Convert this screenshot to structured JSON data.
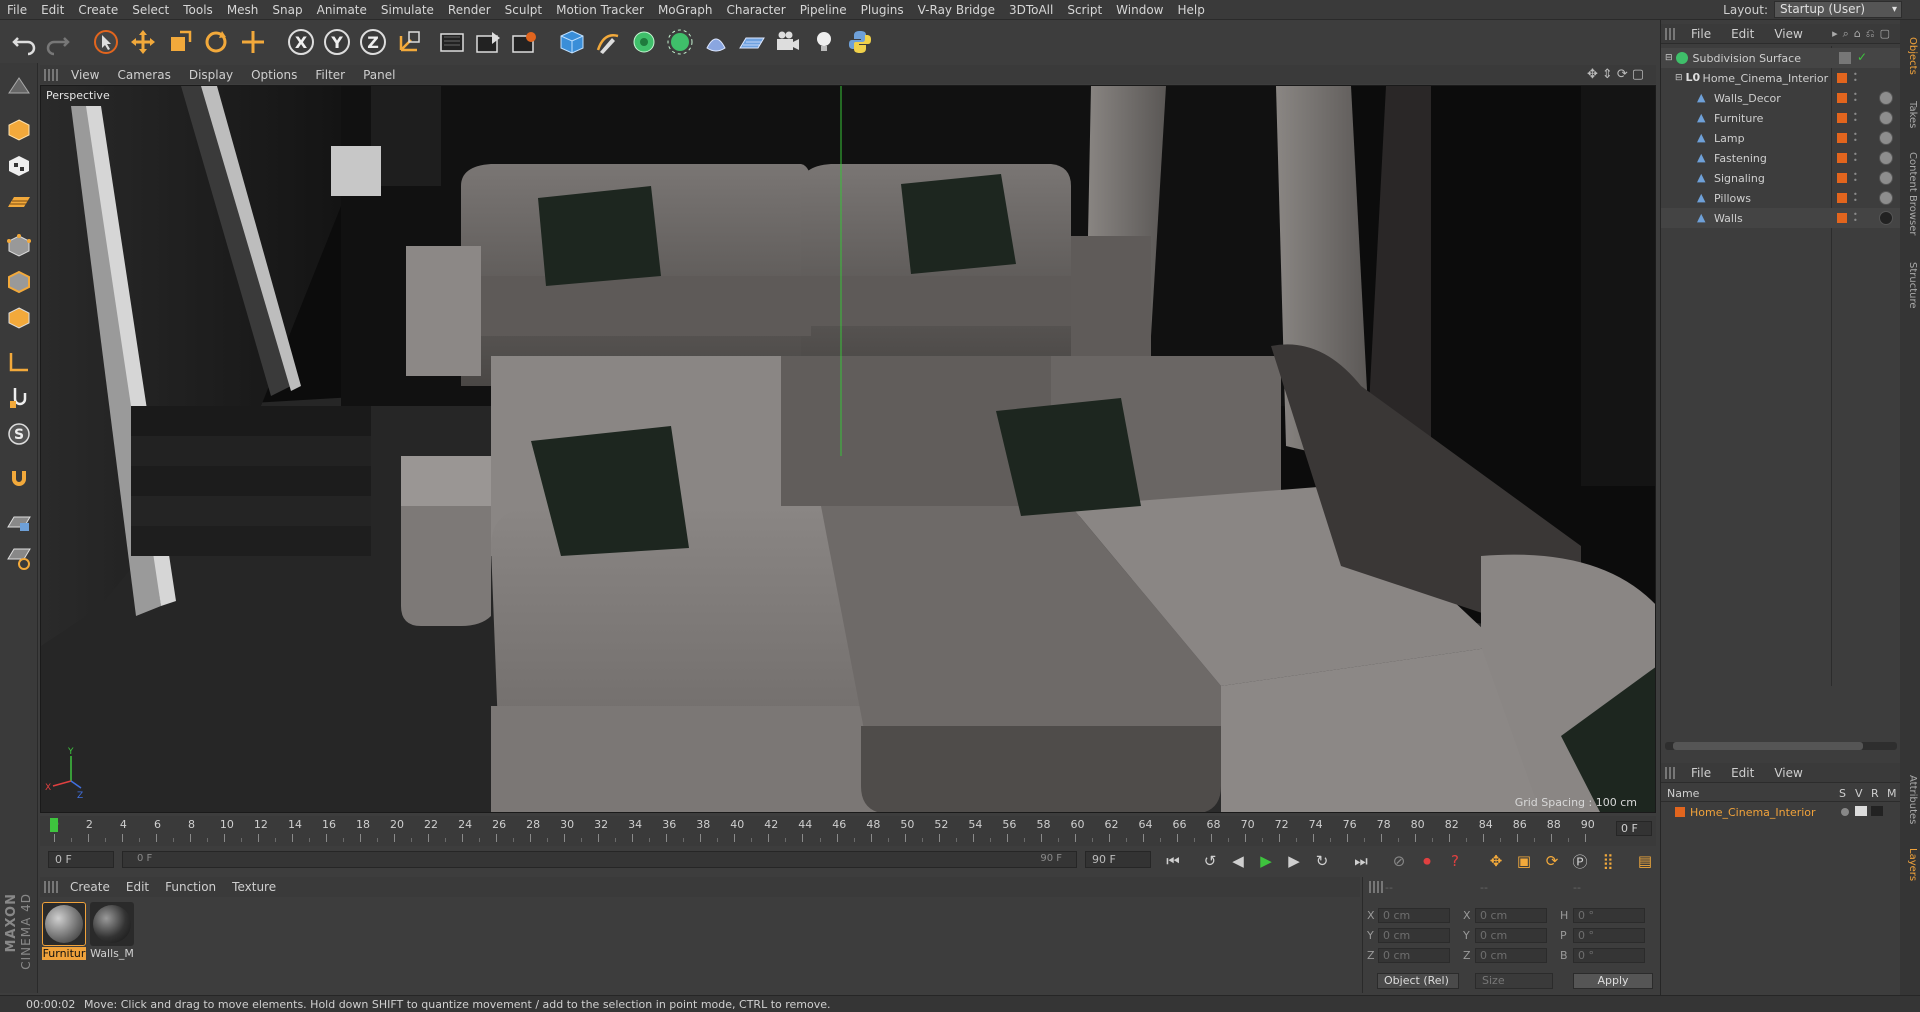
{
  "menubar": {
    "items": [
      "File",
      "Edit",
      "Create",
      "Select",
      "Tools",
      "Mesh",
      "Snap",
      "Animate",
      "Simulate",
      "Render",
      "Sculpt",
      "Motion Tracker",
      "MoGraph",
      "Character",
      "Pipeline",
      "Plugins",
      "V-Ray Bridge",
      "3DToAll",
      "Script",
      "Window",
      "Help"
    ],
    "layout_label": "Layout:",
    "layout_value": "Startup (User)"
  },
  "toolbar": {
    "axis_x": "X",
    "axis_y": "Y",
    "axis_z": "Z"
  },
  "viewport": {
    "menu": [
      "View",
      "Cameras",
      "Display",
      "Options",
      "Filter",
      "Panel"
    ],
    "camera_label": "Perspective",
    "grid_spacing": "Grid Spacing : 100 cm",
    "axis_y": "Y",
    "axis_x": "X",
    "axis_z": "Z"
  },
  "timeline": {
    "ticks": [
      "0",
      "2",
      "4",
      "6",
      "8",
      "10",
      "12",
      "14",
      "16",
      "18",
      "20",
      "22",
      "24",
      "26",
      "28",
      "30",
      "32",
      "34",
      "36",
      "38",
      "40",
      "42",
      "44",
      "46",
      "48",
      "50",
      "52",
      "54",
      "56",
      "58",
      "60",
      "62",
      "64",
      "66",
      "68",
      "70",
      "72",
      "74",
      "76",
      "78",
      "80",
      "82",
      "84",
      "86",
      "88",
      "90"
    ],
    "current_frame": "0 F",
    "start_field": "0 F",
    "range_start": "0 F",
    "range_end": "90 F",
    "end_field": "90 F"
  },
  "materials": {
    "menu": [
      "Create",
      "Edit",
      "Function",
      "Texture"
    ],
    "items": [
      {
        "name": "Furnitur",
        "selected": true
      },
      {
        "name": "Walls_M",
        "selected": false
      }
    ]
  },
  "coordinates": {
    "rows": [
      {
        "l1": "X",
        "v1": "0 cm",
        "l2": "X",
        "v2": "0 cm",
        "l3": "H",
        "v3": "0 °"
      },
      {
        "l1": "Y",
        "v1": "0 cm",
        "l2": "Y",
        "v2": "0 cm",
        "l3": "P",
        "v3": "0 °"
      },
      {
        "l1": "Z",
        "v1": "0 cm",
        "l2": "Z",
        "v2": "0 cm",
        "l3": "B",
        "v3": "0 °"
      }
    ],
    "mode": "Object (Rel)",
    "size": "Size",
    "apply": "Apply",
    "dash1": "--",
    "dash2": "--",
    "dash3": "--"
  },
  "objects": {
    "menu": [
      "File",
      "Edit",
      "View"
    ],
    "items": [
      {
        "name": "Subdivision Surface",
        "level": 0
      },
      {
        "name": "Home_Cinema_Interior",
        "level": 1
      },
      {
        "name": "Walls_Decor",
        "level": 2
      },
      {
        "name": "Furniture",
        "level": 2
      },
      {
        "name": "Lamp",
        "level": 2
      },
      {
        "name": "Fastening",
        "level": 2
      },
      {
        "name": "Signaling",
        "level": 2
      },
      {
        "name": "Pillows",
        "level": 2
      },
      {
        "name": "Walls",
        "level": 2
      }
    ]
  },
  "layers": {
    "menu": [
      "File",
      "Edit",
      "View"
    ],
    "columns": {
      "name": "Name",
      "s": "S",
      "v": "V",
      "r": "R",
      "m": "M"
    },
    "items": [
      {
        "name": "Home_Cinema_Interior"
      }
    ]
  },
  "side_tabs": [
    "Objects",
    "Takes",
    "Content Browser",
    "Structure",
    "Attributes",
    "Layers"
  ],
  "status": {
    "time": "00:00:02",
    "message": "Move: Click and drag to move elements. Hold down SHIFT to quantize movement / add to the selection in point mode, CTRL to remove."
  },
  "brand": {
    "maxon": "MAXON",
    "product": "CINEMA 4D"
  },
  "colors": {
    "accent_orange": "#e2651e",
    "selection_orange": "#f0a23b",
    "play_green": "#3ec43e",
    "viewport_bg": "#0c0c0c"
  }
}
